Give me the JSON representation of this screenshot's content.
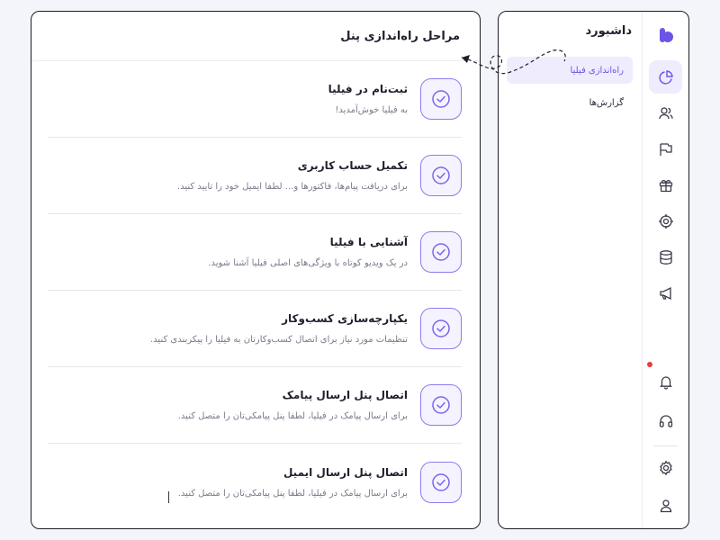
{
  "main": {
    "title": "مراحل راه‌اندازی پنل",
    "steps": [
      {
        "title": "ثبت‌نام در فیلیا",
        "desc": "به فیلیا خوش‌آمدید!"
      },
      {
        "title": "تکمیل حساب کاربری",
        "desc": "برای دریافت پیام‌ها، فاکتورها و... لطفا ایمیل خود را تایید کنید."
      },
      {
        "title": "آشنایی با فیلیا",
        "desc": "در یک ویدیو کوتاه با ویژگی‌های اصلی فیلیا آشنا شوید."
      },
      {
        "title": "یکپارچه‌سازی کسب‌وکار",
        "desc": "تنظیمات مورد نیاز برای اتصال کسب‌وکارتان به فیلیا را پیکربندی کنید."
      },
      {
        "title": "اتصال پنل ارسال پیامک",
        "desc": "برای ارسال پیامک در فیلیا، لطفا پنل پیامکی‌تان را متصل کنید."
      },
      {
        "title": "اتصال پنل ارسال ایمیل",
        "desc": "برای ارسال پیامک در فیلیا، لطفا پنل پیامکی‌تان را متصل کنید."
      }
    ]
  },
  "sidebar": {
    "title": "داشبورد",
    "items": [
      {
        "label": "راه‌اندازی فیلیا",
        "active": true
      },
      {
        "label": "گزارش‌ها",
        "active": false
      }
    ]
  },
  "rail": {
    "icons": [
      "logo-icon",
      "dashboard-pie-icon",
      "users-icon",
      "flag-icon",
      "gift-icon",
      "target-icon",
      "database-icon",
      "megaphone-icon",
      "bell-icon",
      "headset-icon",
      "settings-icon",
      "profile-icon"
    ]
  },
  "colors": {
    "accent": "#6b55e6",
    "accent_light": "#efecfd",
    "notification": "#ec3a3a",
    "border": "#1e1e26"
  }
}
